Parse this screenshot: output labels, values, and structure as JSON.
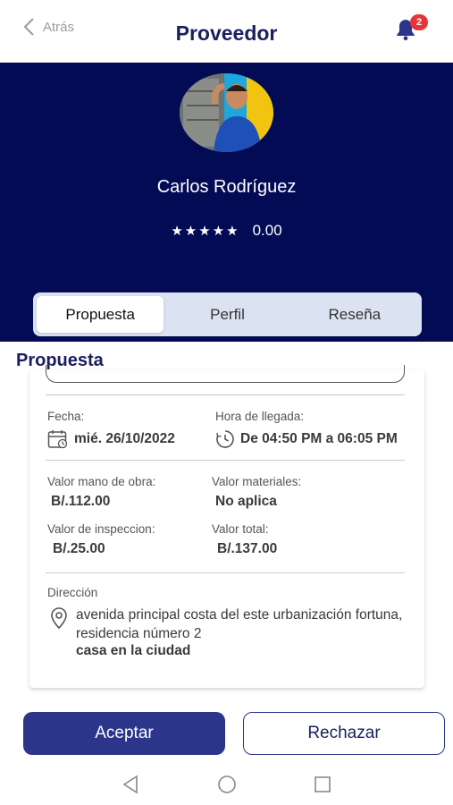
{
  "header": {
    "back_label": "Atrás",
    "title": "Proveedor",
    "notification_count": "2"
  },
  "profile": {
    "name": "Carlos Rodríguez",
    "stars": "★★★★★",
    "rating": "0.00"
  },
  "tabs": [
    {
      "label": "Propuesta",
      "active": true
    },
    {
      "label": "Perfil",
      "active": false
    },
    {
      "label": "Reseña",
      "active": false
    }
  ],
  "section_title": "Propuesta",
  "proposal": {
    "date_label": "Fecha:",
    "date_value": "mié. 26/10/2022",
    "arrival_label": "Hora de llegada:",
    "arrival_value": "De 04:50 PM a 06:05 PM",
    "labor_label": "Valor mano de obra:",
    "labor_value": "B/.112.00",
    "materials_label": "Valor materiales:",
    "materials_value": "No aplica",
    "inspection_label": "Valor de inspeccion:",
    "inspection_value": "B/.25.00",
    "total_label": "Valor total:",
    "total_value": "B/.137.00",
    "address_label": "Dirección",
    "address_line": "avenida principal costa del este urbanización fortuna, residencia número 2",
    "address_detail": "casa en la ciudad"
  },
  "actions": {
    "accept_label": "Aceptar",
    "reject_label": "Rechazar"
  },
  "colors": {
    "brand_dark": "#030b54",
    "title_navy": "#1a1f60",
    "button_blue": "#2b3589",
    "badge_red": "#e3363b"
  }
}
